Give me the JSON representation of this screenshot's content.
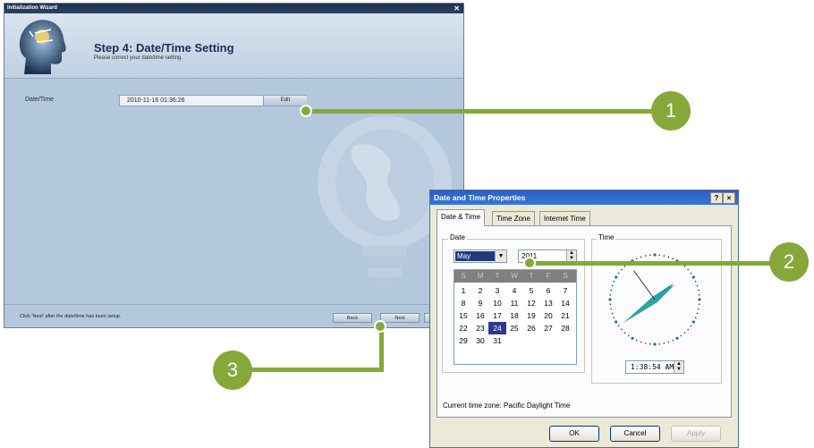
{
  "wizard": {
    "title": "Initialization Wizard",
    "close_glyph": "✕",
    "step_title": "Step 4: Date/Time Setting",
    "step_subtitle": "Please correct your date/time setting.",
    "datetime_label": "Date/Time",
    "datetime_value": "2010-11-16   01:36:26",
    "edit_label": "Edit",
    "footer_text": "Click 'Next' after the date/time has been setup.",
    "back_label": "Back",
    "next_label": "Next",
    "cancel_label": ""
  },
  "callouts": [
    "1",
    "2",
    "3"
  ],
  "colors": {
    "callout": "#86a83a",
    "wizard_bg": "#b3c8dd",
    "dialog_title": "#2a5ec2"
  },
  "dialog": {
    "title": "Date and Time Properties",
    "help_glyph": "?",
    "close_glyph": "×",
    "tabs": [
      {
        "label": "Date & Time"
      },
      {
        "label": "Time Zone"
      },
      {
        "label": "Internet Time"
      }
    ],
    "date_group_label": "Date",
    "time_group_label": "Time",
    "month": "May",
    "year": "2011",
    "weekday_headers": [
      "S",
      "M",
      "T",
      "W",
      "T",
      "F",
      "S"
    ],
    "calendar_rows": [
      [
        "",
        "",
        "",
        "",
        "",
        "",
        ""
      ],
      [
        "1",
        "2",
        "3",
        "4",
        "5",
        "6",
        "7"
      ],
      [
        "8",
        "9",
        "10",
        "11",
        "12",
        "13",
        "14"
      ],
      [
        "15",
        "16",
        "17",
        "18",
        "19",
        "20",
        "21"
      ],
      [
        "22",
        "23",
        "24",
        "25",
        "26",
        "27",
        "28"
      ],
      [
        "29",
        "30",
        "31",
        "",
        "",
        "",
        ""
      ]
    ],
    "selected_day": "24",
    "time_value": "1:38:54 AM",
    "timezone_text": "Current time zone:  Pacific Daylight Time",
    "ok_label": "OK",
    "cancel_label": "Cancel",
    "apply_label": "Apply"
  }
}
